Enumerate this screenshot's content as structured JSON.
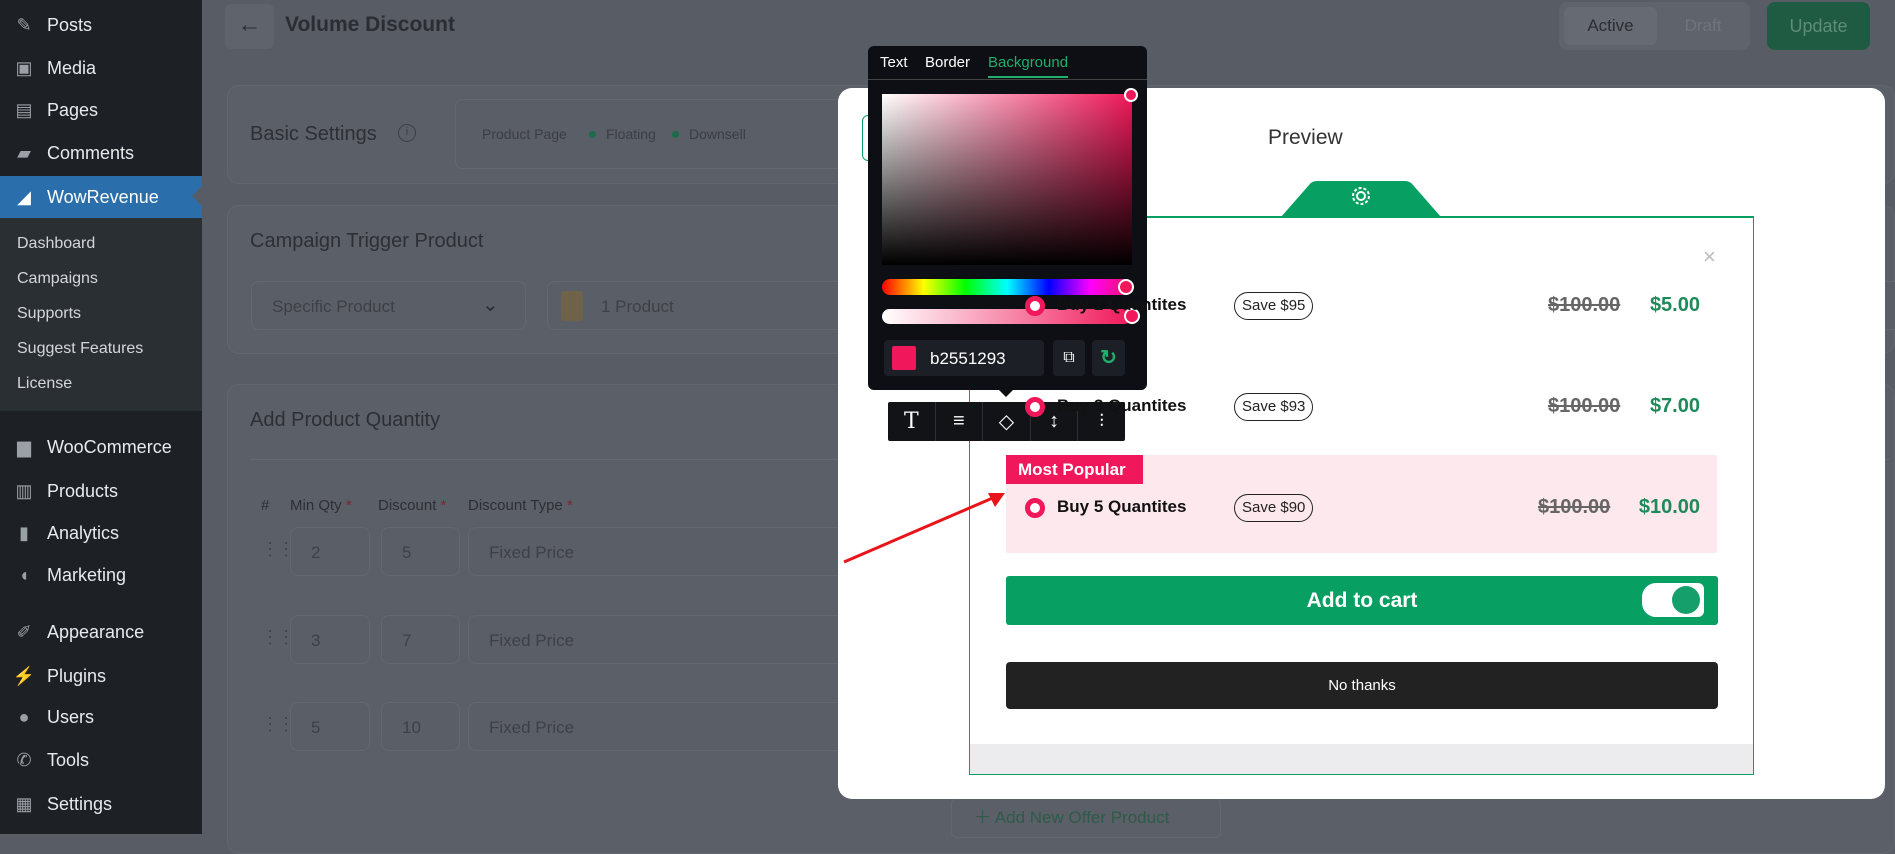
{
  "sidebar": {
    "items": [
      {
        "label": "Posts",
        "icon": "pin-icon"
      },
      {
        "label": "Media",
        "icon": "media-icon"
      },
      {
        "label": "Pages",
        "icon": "pages-icon"
      },
      {
        "label": "Comments",
        "icon": "comment-icon"
      },
      {
        "label": "WowRevenue",
        "icon": "wowrevenue-icon"
      },
      {
        "label": "WooCommerce",
        "icon": "woo-icon"
      },
      {
        "label": "Products",
        "icon": "archive-icon"
      },
      {
        "label": "Analytics",
        "icon": "chart-icon"
      },
      {
        "label": "Marketing",
        "icon": "megaphone-icon"
      },
      {
        "label": "Appearance",
        "icon": "brush-icon"
      },
      {
        "label": "Plugins",
        "icon": "plug-icon"
      },
      {
        "label": "Users",
        "icon": "user-icon"
      },
      {
        "label": "Tools",
        "icon": "wrench-icon"
      },
      {
        "label": "Settings",
        "icon": "settings-icon"
      }
    ],
    "submenu": [
      "Dashboard",
      "Campaigns",
      "Supports",
      "Suggest Features",
      "License"
    ]
  },
  "header": {
    "title": "Volume Discount",
    "status_options": [
      "Active",
      "Draft"
    ],
    "status_selected": "Active",
    "update_label": "Update"
  },
  "basic": {
    "title": "Basic Settings",
    "chips": [
      "Product Page",
      "Floating",
      "Downsell"
    ]
  },
  "trigger": {
    "title": "Campaign Trigger Product",
    "select_value": "Specific Product",
    "product_value": "1 Product"
  },
  "quantity": {
    "title": "Add Product Quantity",
    "columns": [
      "#",
      "Min Qty",
      "Discount",
      "Discount Type"
    ],
    "rows": [
      {
        "min": "2",
        "discount": "5",
        "type": "Fixed Price"
      },
      {
        "min": "3",
        "discount": "7",
        "type": "Fixed Price"
      },
      {
        "min": "5",
        "discount": "10",
        "type": "Fixed Price"
      }
    ],
    "add_offer_label": "Add New Offer Product"
  },
  "preview": {
    "title": "Preview",
    "close": "×",
    "options": [
      {
        "label": "Buy 2 Quantites",
        "save": "Save $95",
        "old": "$100.00",
        "new": "$5.00"
      },
      {
        "label": "Buy 3 Quantites",
        "save": "Save $93",
        "old": "$100.00",
        "new": "$7.00"
      },
      {
        "label": "Buy 5 Quantites",
        "save": "Save $90",
        "old": "$100.00",
        "new": "$10.00"
      }
    ],
    "badge": "Most Popular",
    "add_to_cart": "Add to cart",
    "no_thanks": "No thanks"
  },
  "picker": {
    "tabs": [
      "Text",
      "Border",
      "Background"
    ],
    "active_tab": "Background",
    "hex": "b2551293",
    "swatch": "#f0185a"
  },
  "colors": {
    "accent": "#08a062",
    "badge": "#f0185a",
    "highlight": "#fde8ee"
  }
}
